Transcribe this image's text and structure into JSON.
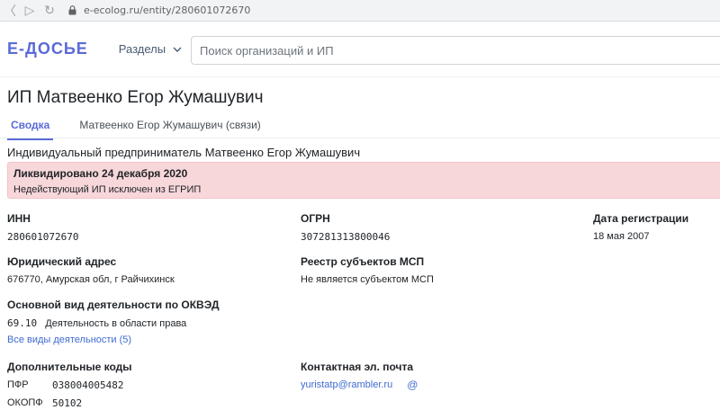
{
  "browser": {
    "url": "e-ecolog.ru/entity/280601072670"
  },
  "header": {
    "logo": "Е-ДОСЬЕ",
    "sections_label": "Разделы",
    "search_placeholder": "Поиск организаций и ИП"
  },
  "page": {
    "title": "ИП Матвеенко Егор Жумашувич",
    "tabs": [
      {
        "label": "Сводка"
      },
      {
        "label": "Матвеенко Егор Жумашувич (связи)"
      }
    ],
    "full_name": "Индивидуальный предприниматель Матвеенко Егор Жумашувич"
  },
  "alert": {
    "title": "Ликвидировано 24 декабря 2020",
    "text": "Недействующий ИП исключен из ЕГРИП"
  },
  "fields": {
    "inn": {
      "label": "ИНН",
      "value": "280601072670"
    },
    "ogrn": {
      "label": "ОГРН",
      "value": "307281313800046"
    },
    "reg_date": {
      "label": "Дата регистрации",
      "value": "18 мая 2007"
    },
    "address": {
      "label": "Юридический адрес",
      "value": "676770, Амурская обл, г Райчихинск"
    },
    "msp": {
      "label": "Реестр субъектов МСП",
      "value": "Не является субъектом МСП"
    },
    "okved": {
      "label": "Основной вид деятельности по ОКВЭД",
      "code": "69.10",
      "text": "Деятельность в области права",
      "all_link": "Все виды деятельности (5)"
    },
    "codes": {
      "label": "Дополнительные коды",
      "pfr_key": "ПФР",
      "pfr_value": "038004005482",
      "okopf_key": "ОКОПФ",
      "okopf_value": "50102"
    },
    "email": {
      "label": "Контактная эл. почта",
      "value": "yuristatp@rambler.ru",
      "at_symbol": "@"
    }
  }
}
